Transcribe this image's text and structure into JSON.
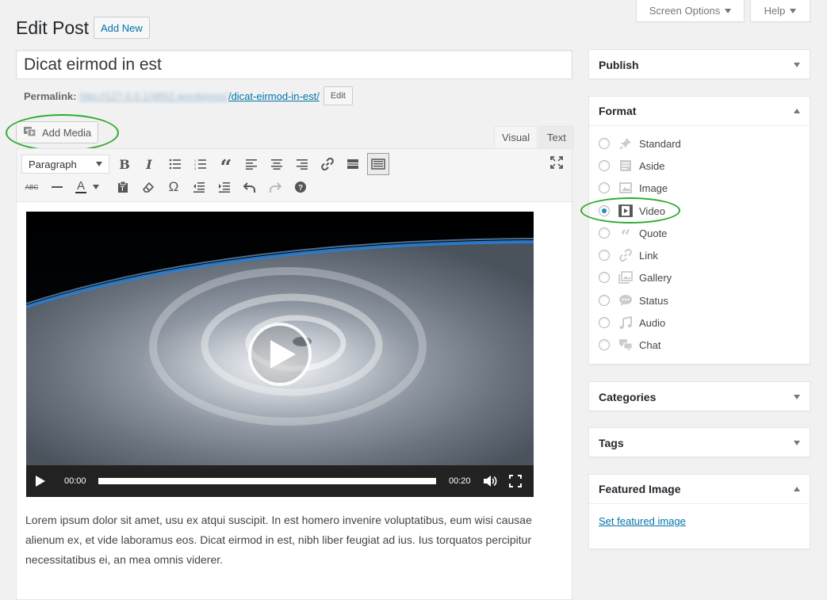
{
  "header": {
    "page_title": "Edit Post",
    "add_new_label": "Add New",
    "screen_options_label": "Screen Options",
    "help_label": "Help"
  },
  "post": {
    "title": "Dicat eirmod in est",
    "permalink_label": "Permalink:",
    "permalink_base": "http://127.0.0.1/4852.wordpress/",
    "permalink_slug": "/dicat-eirmod-in-est/",
    "permalink_edit_label": "Edit"
  },
  "editor": {
    "add_media_label": "Add Media",
    "tab_visual": "Visual",
    "tab_text": "Text",
    "format_select_value": "Paragraph",
    "video": {
      "current_time": "00:00",
      "duration": "00:20",
      "progress": 0
    },
    "body_text": "Lorem ipsum dolor sit amet, usu ex atqui suscipit. In est homero invenire voluptatibus, eum wisi causae alienum ex, et vide laboramus eos. Dicat eirmod in est, nibh liber feugiat ad ius. Ius torquatos percipitur necessitatibus ei, an mea omnis viderer."
  },
  "sidebar": {
    "publish_title": "Publish",
    "format_title": "Format",
    "formats": [
      {
        "label": "Standard",
        "icon": "pin-icon",
        "checked": false
      },
      {
        "label": "Aside",
        "icon": "aside-icon",
        "checked": false
      },
      {
        "label": "Image",
        "icon": "image-icon",
        "checked": false
      },
      {
        "label": "Video",
        "icon": "video-icon",
        "checked": true
      },
      {
        "label": "Quote",
        "icon": "quote-icon",
        "checked": false
      },
      {
        "label": "Link",
        "icon": "link-icon",
        "checked": false
      },
      {
        "label": "Gallery",
        "icon": "gallery-icon",
        "checked": false
      },
      {
        "label": "Status",
        "icon": "status-icon",
        "checked": false
      },
      {
        "label": "Audio",
        "icon": "audio-icon",
        "checked": false
      },
      {
        "label": "Chat",
        "icon": "chat-icon",
        "checked": false
      }
    ],
    "categories_title": "Categories",
    "tags_title": "Tags",
    "featured_image_title": "Featured Image",
    "set_featured_image_label": "Set featured image"
  },
  "colors": {
    "accent": "#0073aa",
    "highlight_ellipse": "#2eaa2e",
    "background": "#f1f1f1"
  }
}
